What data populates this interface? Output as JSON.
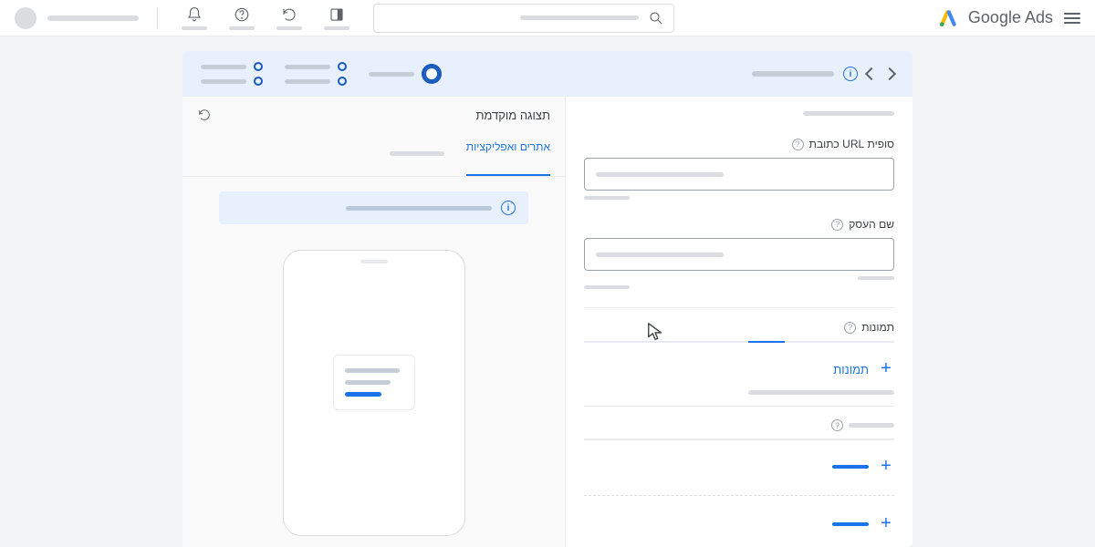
{
  "header": {
    "brand": "Google Ads"
  },
  "preview": {
    "title": "תצוגה מוקדמת",
    "tabs": {
      "active": "אתרים ואפליקציות"
    }
  },
  "form": {
    "url_suffix": {
      "label": "סופית URL כתובת"
    },
    "business_name": {
      "label": "שם העסק"
    },
    "images": {
      "label": "תמונות",
      "add_label": "תמונות"
    }
  }
}
